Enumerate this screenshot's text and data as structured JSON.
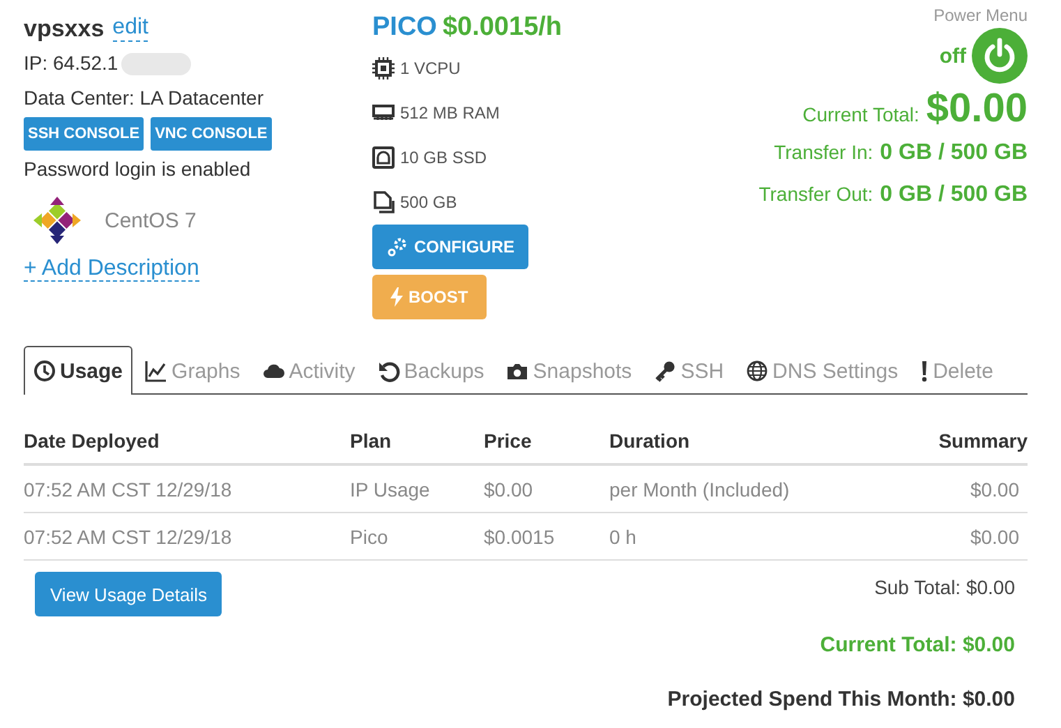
{
  "server": {
    "name": "vpsxxs",
    "edit_link": "edit",
    "ip": "IP: 64.52.1",
    "data_center": "Data Center: LA Datacenter",
    "console_buttons": [
      "SSH CONSOLE",
      "VNC CONSOLE"
    ],
    "password_note": "Password login is enabled",
    "os": "CentOS 7",
    "add_description": "+ Add Description"
  },
  "plan": {
    "name": "PICO",
    "rate": "$0.0015/h",
    "specs": [
      {
        "kind": "cpu",
        "text": "1 VCPU"
      },
      {
        "kind": "ram",
        "text": "512 MB RAM"
      },
      {
        "kind": "disk",
        "text": "10 GB SSD"
      },
      {
        "kind": "transfer",
        "text": "500 GB"
      }
    ],
    "buttons": [
      {
        "kind": "configure",
        "label": "CONFIGURE"
      },
      {
        "kind": "boost",
        "label": "BOOST"
      }
    ]
  },
  "power": {
    "title": "Power Menu",
    "state_label": "off"
  },
  "totals": {
    "current_label": "Current Total:",
    "current_value": "$0.00",
    "transfer": [
      {
        "label": "Transfer In:",
        "value": "0 GB / 500 GB"
      },
      {
        "label": "Transfer Out:",
        "value": "0 GB / 500 GB"
      }
    ]
  },
  "tabs": [
    {
      "kind": "clock",
      "label": "Usage",
      "selected": true
    },
    {
      "kind": "graph",
      "label": "Graphs",
      "selected": false
    },
    {
      "kind": "cloud",
      "label": "Activity",
      "selected": false
    },
    {
      "kind": "undo",
      "label": "Backups",
      "selected": false
    },
    {
      "kind": "camera",
      "label": "Snapshots",
      "selected": false
    },
    {
      "kind": "key",
      "label": "SSH",
      "selected": false
    },
    {
      "kind": "globe",
      "label": "DNS Settings",
      "selected": false
    },
    {
      "kind": "exclaim",
      "label": "Delete",
      "selected": false
    }
  ],
  "table": {
    "columns": [
      "Date Deployed",
      "Plan",
      "Price",
      "Duration",
      "Summary"
    ],
    "rows": [
      [
        "07:52 AM CST 12/29/18",
        "IP Usage",
        "$0.00",
        "per Month (Included)",
        "$0.00"
      ],
      [
        "07:52 AM CST 12/29/18",
        "Pico",
        "$0.0015",
        "0 h",
        "$0.00"
      ]
    ]
  },
  "usage_button": "View Usage Details",
  "sub_total": "Sub Total: $0.00",
  "current_total": "Current Total: $0.00",
  "projected": "Projected Spend This Month: $0.00"
}
